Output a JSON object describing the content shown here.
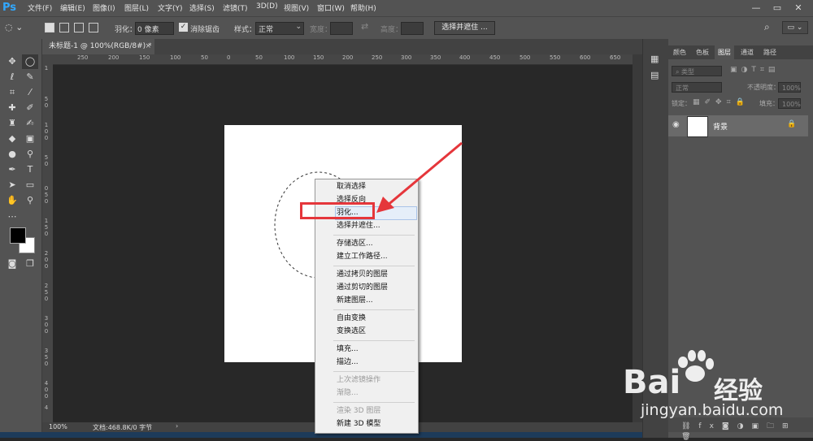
{
  "app": {
    "logo": "Ps"
  },
  "menu": [
    "文件(F)",
    "编辑(E)",
    "图像(I)",
    "图层(L)",
    "文字(Y)",
    "选择(S)",
    "滤镜(T)",
    "3D(D)",
    "视图(V)",
    "窗口(W)",
    "帮助(H)"
  ],
  "options": {
    "feather_label": "羽化：",
    "feather_value": "0 像素",
    "antialias_label": "消除锯齿",
    "antialias_checked": true,
    "style_label": "样式：",
    "style_value": "正常",
    "width_label": "宽度：",
    "height_label": "高度：",
    "select_mask_button": "选择并遮住 ..."
  },
  "document": {
    "tab_title": "未标题-1 @ 100%(RGB/8#) *",
    "zoom": "100%",
    "doc_info": "文档:468.8K/0 字节"
  },
  "rulers": {
    "h": [
      "250",
      "200",
      "150",
      "100",
      "50",
      "0",
      "50",
      "100",
      "150",
      "200",
      "250",
      "300",
      "350",
      "400",
      "450",
      "500",
      "550",
      "600",
      "650"
    ],
    "v": [
      "1",
      "5",
      "0",
      "1",
      "0",
      "0",
      "5",
      "0",
      "0",
      "5",
      "0",
      "1",
      "5",
      "0",
      "2",
      "0",
      "0",
      "2",
      "5",
      "0",
      "3",
      "0",
      "0",
      "3",
      "5",
      "0",
      "4",
      "0",
      "0",
      "4",
      "5",
      "0"
    ]
  },
  "context_menu": {
    "items": [
      {
        "label": "取消选择",
        "disabled": false
      },
      {
        "label": "选择反向",
        "disabled": false
      },
      {
        "label": "羽化...",
        "disabled": false,
        "highlighted": true
      },
      {
        "label": "选择并遮住...",
        "disabled": false
      },
      {
        "label": "存储选区...",
        "disabled": false
      },
      {
        "label": "建立工作路径...",
        "disabled": false
      },
      {
        "label": "通过拷贝的图层",
        "disabled": false
      },
      {
        "label": "通过剪切的图层",
        "disabled": false
      },
      {
        "label": "新建图层...",
        "disabled": false
      },
      {
        "label": "自由变换",
        "disabled": false
      },
      {
        "label": "变换选区",
        "disabled": false
      },
      {
        "label": "填充...",
        "disabled": false
      },
      {
        "label": "描边...",
        "disabled": false
      },
      {
        "label": "上次滤镜操作",
        "disabled": true
      },
      {
        "label": "渐隐...",
        "disabled": true
      },
      {
        "label": "渲染 3D 图层",
        "disabled": true
      },
      {
        "label": "新建 3D 模型",
        "disabled": false
      }
    ]
  },
  "panels": {
    "tabs": [
      "颜色",
      "色板",
      "图层",
      "通道",
      "路径"
    ],
    "active_tab": "图层",
    "kind_filter": "类型",
    "blend_mode": "正常",
    "opacity_label": "不透明度：",
    "opacity_value": "100%",
    "lock_label": "锁定：",
    "fill_label": "填充：",
    "fill_value": "100%",
    "layer_name": "背景"
  },
  "watermark": {
    "brand": "Bai",
    "brand2": "经验",
    "url": "jingyan.baidu.com"
  },
  "colors": {
    "accent_red": "#e5363b",
    "ps_blue": "#31a8ff",
    "paw_color": "#ffffff"
  },
  "icons": [
    "move-icon",
    "marquee-ellipse-icon",
    "lasso-icon",
    "quick-select-icon",
    "crop-icon",
    "eyedropper-icon",
    "healing-icon",
    "brush-icon",
    "stamp-icon",
    "history-brush-icon",
    "eraser-icon",
    "gradient-icon",
    "blur-icon",
    "dodge-icon",
    "pen-icon",
    "type-icon",
    "path-select-icon",
    "shape-icon",
    "hand-icon",
    "zoom-icon",
    "more-icon",
    "color-swatch-icon",
    "quick-mask-icon",
    "screen-mode-icon",
    "search-icon",
    "workspace-icon"
  ]
}
